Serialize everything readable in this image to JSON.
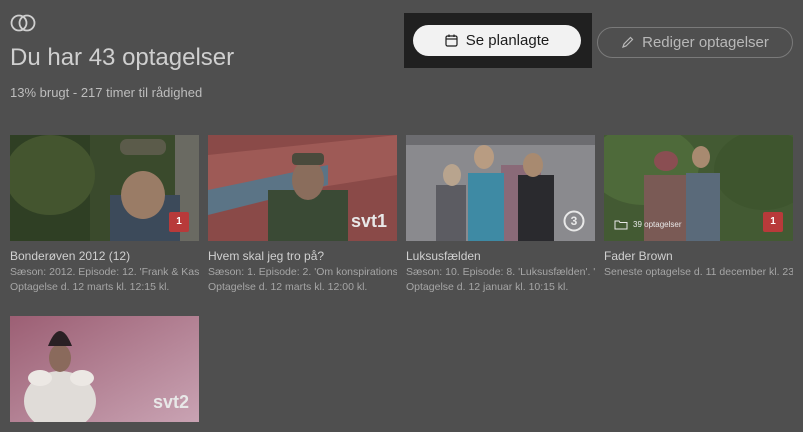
{
  "header": {
    "title": "Du har 43 optagelser",
    "usage": "13% brugt - 217 timer til rådighed",
    "logo_icon": "toggle-rings-icon"
  },
  "buttons": {
    "scheduled": {
      "label": "Se planlagte",
      "icon": "calendar-icon"
    },
    "edit": {
      "label": "Rediger optagelser",
      "icon": "pencil-icon"
    }
  },
  "recordings": [
    {
      "title": "Bonderøven 2012 (12)",
      "info": "Sæson: 2012. Episode: 12. 'Frank & Kast",
      "recorded": "Optagelse d. 12 marts kl. 12:15 kl.",
      "channel": "1"
    },
    {
      "title": "Hvem skal jeg tro på?",
      "info": "Sæson: 1. Episode: 2. 'Om konspirations",
      "recorded": "Optagelse d. 12 marts kl. 12:00 kl.",
      "channel": "svt1"
    },
    {
      "title": "Luksusfælden",
      "info": "Sæson: 10. Episode: 8. 'Luksusfælden'. '",
      "recorded": "Optagelse d. 12 januar kl. 10:15 kl.",
      "channel": "3"
    },
    {
      "title": "Fader Brown",
      "info": "Seneste optagelse d. 11 december kl. 23",
      "folder_label": "39 optagelser",
      "channel": "1"
    },
    {
      "title": "",
      "info": "",
      "recorded": "",
      "channel": "svt2"
    }
  ]
}
